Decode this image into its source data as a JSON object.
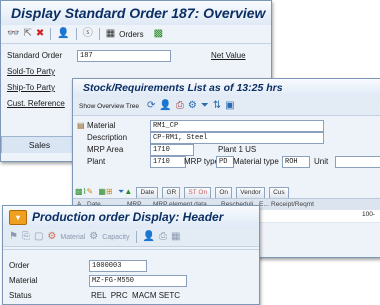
{
  "w1": {
    "title": "Display Standard Order 187: Overview",
    "toolbar": {
      "orders_label": "Orders"
    },
    "standard_order_label": "Standard Order",
    "standard_order_value": "187",
    "net_value_label": "Net Value",
    "sold_to_label": "Sold-To Party",
    "ship_to_label": "Ship-To Party",
    "cust_ref_label": "Cust. Reference",
    "sales_tab": "Sales"
  },
  "w2": {
    "title": "Stock/Requirements List as of 13:25 hrs",
    "toolbar": {
      "show_overview_tree": "Show Overview Tree"
    },
    "material_label": "Material",
    "material_value": "RM1_CP",
    "description_label": "Description",
    "description_value": "CP-RM1, Steel",
    "mrp_area_label": "MRP Area",
    "mrp_area_value": "1710",
    "mrp_area_text": "Plant 1 US",
    "plant_label": "Plant",
    "plant_value": "1710",
    "mrp_type_label": "MRP type",
    "mrp_type_value": "PD",
    "material_type_label": "Material type",
    "material_type_value": "ROH",
    "unit_label": "Unit",
    "btns": {
      "date": "Date",
      "gr": "GR",
      "st_on": "ST On",
      "on": "On",
      "vendor": "Vendor",
      "cus": "Cus"
    },
    "cols": {
      "a": "A",
      "date": "Date",
      "mrp": "MRP...",
      "mrp_element_data": "MRP element data",
      "rescheduling": "Rescheduli...",
      "e": "E...",
      "receipt_reqmt": "Receipt/Reqmt"
    },
    "row_value": "100-"
  },
  "w3": {
    "title": "Production order Display: Header",
    "toolbar": {
      "material": "Material",
      "capacity": "Capacity"
    },
    "order_label": "Order",
    "order_value": "1000003",
    "material_label": "Material",
    "material_value": "MZ-FG-M550",
    "status_label": "Status",
    "status_value": "REL  PRC  MACM SETC"
  }
}
